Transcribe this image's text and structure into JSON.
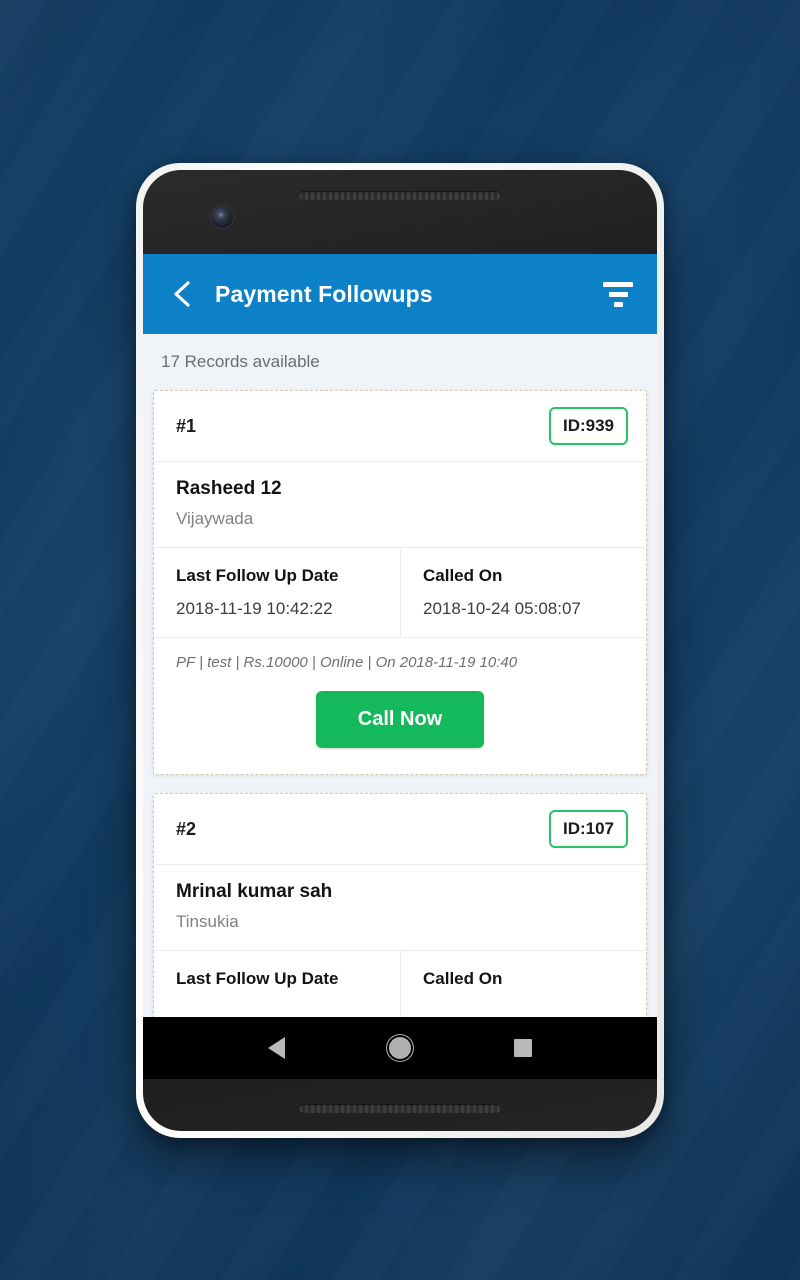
{
  "app": {
    "header": {
      "back_icon": "chevron-left-icon",
      "title": "Payment Followups",
      "filter_icon": "filter-icon"
    },
    "records_summary": "17 Records available",
    "brand_color": "#0d81c7",
    "accent_green": "#13b95a",
    "badge_border_color": "#27c266",
    "labels": {
      "last_follow_up_date": "Last Follow Up Date",
      "called_on": "Called On",
      "call_now": "Call Now"
    },
    "cards": [
      {
        "index": "#1",
        "id_badge": "ID:939",
        "name": "Rasheed 12",
        "city": "Vijaywada",
        "last_follow_up_date": "2018-11-19 10:42:22",
        "called_on": "2018-10-24 05:08:07",
        "note": "PF | test | Rs.10000 | Online | On 2018-11-19 10:40",
        "call_now": "Call Now"
      },
      {
        "index": "#2",
        "id_badge": "ID:107",
        "name": "Mrinal kumar sah",
        "city": "Tinsukia",
        "last_follow_up_date": "",
        "called_on": ""
      }
    ]
  },
  "device": {
    "nav": {
      "back": "nav-back-icon",
      "home": "nav-home-icon",
      "recents": "nav-recents-icon"
    },
    "power_button_color": "#9c5240",
    "volume_button_color": "#b7babe"
  }
}
